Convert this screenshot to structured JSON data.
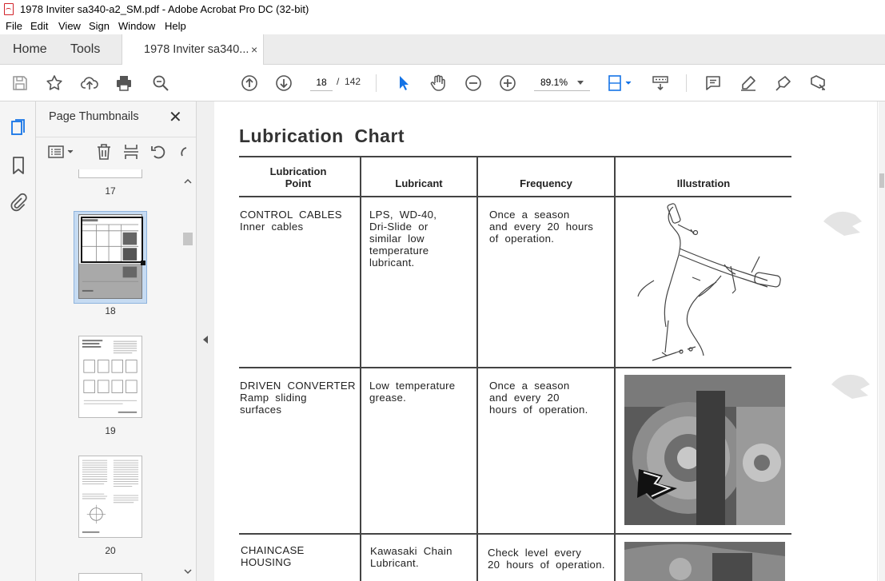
{
  "window": {
    "title": "1978 Inviter sa340-a2_SM.pdf - Adobe Acrobat Pro DC (32-bit)"
  },
  "menu": {
    "items": [
      "File",
      "Edit",
      "View",
      "Sign",
      "Window",
      "Help"
    ]
  },
  "tabs": {
    "home": "Home",
    "tools": "Tools",
    "document": "1978 Inviter sa340...",
    "close": "×"
  },
  "toolbar": {
    "current_page": "18",
    "page_separator": "/",
    "total_pages": "142",
    "zoom": "89.1%"
  },
  "thumbnails": {
    "title": "Page Thumbnails",
    "close": "✕",
    "pages": [
      "17",
      "18",
      "19",
      "20"
    ],
    "selected": "18"
  },
  "document": {
    "title": "Lubrication  Chart",
    "headers": {
      "point": "Lubrication\nPoint",
      "lubricant": "Lubricant",
      "frequency": "Frequency",
      "illustration": "Illustration"
    },
    "rows": [
      {
        "point": "CONTROL  CABLES\nInner  cables",
        "lubricant": "LPS,  WD-40,\nDri-Slide  or\nsimilar  low\ntemperature\nlubricant.",
        "frequency": "Once  a  season\nand  every  20  hours\nof  operation."
      },
      {
        "point": "DRIVEN  CONVERTER\nRamp  sliding\nsurfaces",
        "lubricant": "Low  temperature\ngrease.",
        "frequency": "Once  a  season\nand  every  20\nhours  of  operation."
      },
      {
        "point": "CHAINCASE\nHOUSING",
        "lubricant": "Kawasaki  Chain\nLubricant.",
        "frequency": "Check  level  every\n20  hours  of  operation."
      }
    ]
  },
  "colors": {
    "accent": "#1473e6",
    "pdf_red": "#d1232a",
    "chrome": "#ececec"
  }
}
